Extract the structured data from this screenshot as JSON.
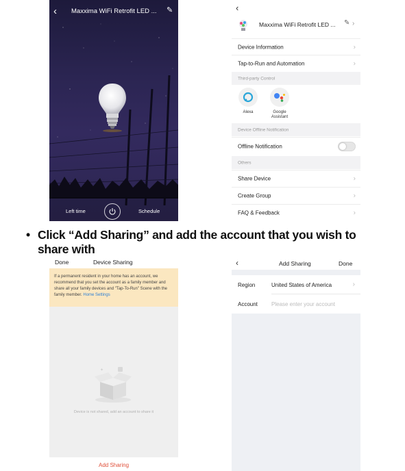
{
  "bulb_screen": {
    "title": "Maxxima WiFi Retrofit LED ...",
    "back_glyph": "‹",
    "edit_glyph": "✎",
    "left_time_label": "Left time",
    "schedule_label": "Schedule"
  },
  "settings_screen": {
    "back_glyph": "‹",
    "device_name": "Maxxima WiFi Retrofit LED ...",
    "edit_glyph": "✎",
    "chevron": "›",
    "rows": {
      "device_information": "Device Information",
      "tap_to_run": "Tap-to-Run and Automation",
      "third_party_header": "Third-party Control",
      "alexa": "Alexa",
      "google_assistant": "Google Assistant",
      "offline_header": "Device Offline Notification",
      "offline_notification": "Offline Notification",
      "others_header": "Others",
      "share_device": "Share Device",
      "create_group": "Create Group",
      "faq_feedback": "FAQ & Feedback"
    },
    "offline_notification_on": false
  },
  "instruction": {
    "bullet": "•",
    "text": "Click “Add Sharing” and add the account that you wish to share with"
  },
  "sharing_screen": {
    "done_label": "Done",
    "title": "Device Sharing",
    "notice_text": "If a permanent resident in your home has an account, we recommend that you set the account as a family member and share all your family devices and \"Tap-To-Run\" Scene with the family member.",
    "notice_link": "Home Settings",
    "empty_text": "Device is not shared, add an account to share it",
    "add_sharing_label": "Add Sharing"
  },
  "add_sharing_screen": {
    "back_glyph": "‹",
    "title": "Add Sharing",
    "done_label": "Done",
    "region_label": "Region",
    "region_value": "United States of America",
    "account_label": "Account",
    "account_placeholder": "Please enter your account",
    "chevron": "›"
  },
  "colors": {
    "accent_red": "#e0503a",
    "notice_bg": "#fbe7c0",
    "link_blue": "#2d7fd3",
    "night_sky": "#2b2552"
  }
}
